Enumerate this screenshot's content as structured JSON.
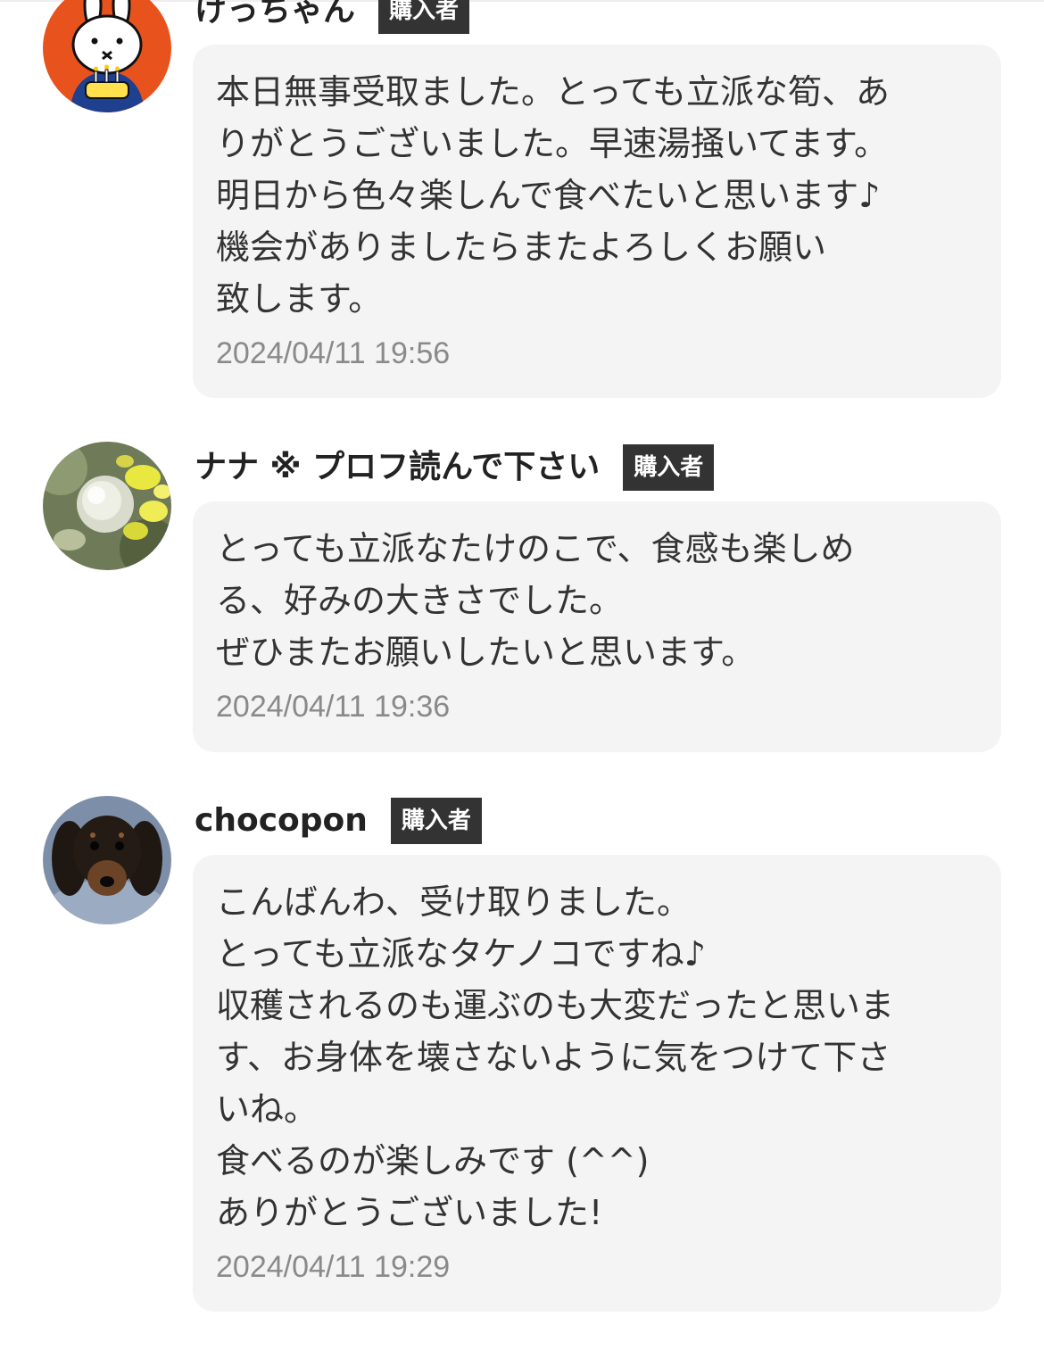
{
  "reviews": [
    {
      "user_name": "けっちゃん",
      "badge": "購入者",
      "avatar": "miffy-avatar",
      "comment": "本日無事受取ました。とっても立派な筍、あ\nりがとうございました。早速湯掻いてます。\n明日から色々楽しんで食べたいと思います♪\n機会がありましたらまたよろしくお願い\n致します。",
      "timestamp": "2024/04/11 19:56"
    },
    {
      "user_name": "ナナ ※ プロフ読んで下さい",
      "badge": "購入者",
      "avatar": "flowers-avatar",
      "comment": "とっても立派なたけのこで、食感も楽しめ\nる、好みの大きさでした。\nぜひまたお願いしたいと思います。",
      "timestamp": "2024/04/11 19:36"
    },
    {
      "user_name": "chocopon",
      "badge": "購入者",
      "avatar": "dog-avatar",
      "comment": "こんばんわ、受け取りました。\nとっても立派なタケノコですね♪\n収穫されるのも運ぶのも大変だったと思いま\nす、お身体を壊さないように気をつけて下さ\nいね。\n食べるのが楽しみです (^^)\nありがとうございました!",
      "timestamp": "2024/04/11 19:29"
    }
  ],
  "colors": {
    "badge_bg": "#333333",
    "bubble_bg": "#f4f4f4",
    "timestamp": "#8a8a8a"
  }
}
